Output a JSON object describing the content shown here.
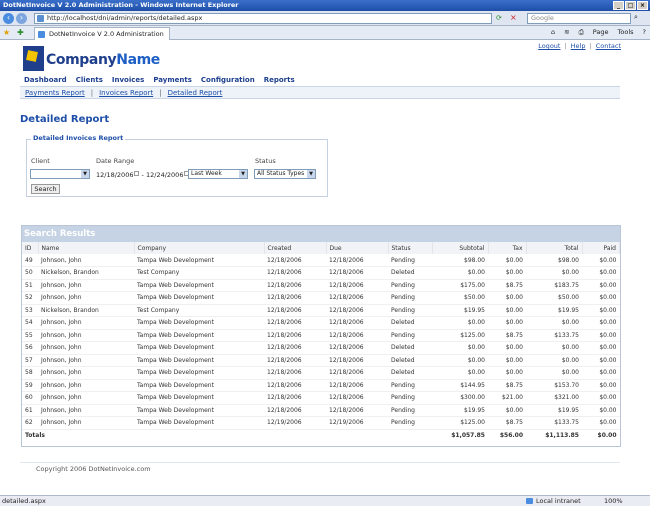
{
  "window": {
    "title": "DotNetInvoice V 2.0 Administration - Windows Internet Explorer"
  },
  "browser": {
    "url": "http://localhost/dni/admin/reports/detailed.aspx",
    "search_placeholder": "Google",
    "tab_title": "DotNetInvoice V 2.0 Administration",
    "tools": {
      "page": "Page",
      "tools": "Tools"
    }
  },
  "header": {
    "company_first": "Company",
    "company_second": "Name",
    "toplinks": [
      "Logout",
      "Help",
      "Contact"
    ]
  },
  "mainnav": [
    "Dashboard",
    "Clients",
    "Invoices",
    "Payments",
    "Configuration",
    "Reports"
  ],
  "subnav": [
    "Payments Report",
    "Invoices Report",
    "Detailed Report"
  ],
  "page_title": "Detailed Report",
  "filters": {
    "legend": "Detailed Invoices Report",
    "client_label": "Client",
    "date_label": "Date Range",
    "date_from": "12/18/2006",
    "date_sep": "-",
    "date_to": "12/24/2006",
    "range_option": "Last Week",
    "status_label": "Status",
    "status_option": "All Status Types",
    "search_button": "Search"
  },
  "results": {
    "title": "Search Results",
    "columns": [
      "ID",
      "Name",
      "Company",
      "Created",
      "Due",
      "Status",
      "Subtotal",
      "Tax",
      "Total",
      "Paid"
    ],
    "rows": [
      [
        "49",
        "Johnson, John",
        "Tampa Web Development",
        "12/18/2006",
        "12/18/2006",
        "Pending",
        "$98.00",
        "$0.00",
        "$98.00",
        "$0.00"
      ],
      [
        "50",
        "Nickelson, Brandon",
        "Test Company",
        "12/18/2006",
        "12/18/2006",
        "Deleted",
        "$0.00",
        "$0.00",
        "$0.00",
        "$0.00"
      ],
      [
        "51",
        "Johnson, John",
        "Tampa Web Development",
        "12/18/2006",
        "12/18/2006",
        "Pending",
        "$175.00",
        "$8.75",
        "$183.75",
        "$0.00"
      ],
      [
        "52",
        "Johnson, John",
        "Tampa Web Development",
        "12/18/2006",
        "12/18/2006",
        "Pending",
        "$50.00",
        "$0.00",
        "$50.00",
        "$0.00"
      ],
      [
        "53",
        "Nickelson, Brandon",
        "Test Company",
        "12/18/2006",
        "12/18/2006",
        "Pending",
        "$19.95",
        "$0.00",
        "$19.95",
        "$0.00"
      ],
      [
        "54",
        "Johnson, John",
        "Tampa Web Development",
        "12/18/2006",
        "12/18/2006",
        "Deleted",
        "$0.00",
        "$0.00",
        "$0.00",
        "$0.00"
      ],
      [
        "55",
        "Johnson, John",
        "Tampa Web Development",
        "12/18/2006",
        "12/18/2006",
        "Pending",
        "$125.00",
        "$8.75",
        "$133.75",
        "$0.00"
      ],
      [
        "56",
        "Johnson, John",
        "Tampa Web Development",
        "12/18/2006",
        "12/18/2006",
        "Deleted",
        "$0.00",
        "$0.00",
        "$0.00",
        "$0.00"
      ],
      [
        "57",
        "Johnson, John",
        "Tampa Web Development",
        "12/18/2006",
        "12/18/2006",
        "Deleted",
        "$0.00",
        "$0.00",
        "$0.00",
        "$0.00"
      ],
      [
        "58",
        "Johnson, John",
        "Tampa Web Development",
        "12/18/2006",
        "12/18/2006",
        "Deleted",
        "$0.00",
        "$0.00",
        "$0.00",
        "$0.00"
      ],
      [
        "59",
        "Johnson, John",
        "Tampa Web Development",
        "12/18/2006",
        "12/18/2006",
        "Pending",
        "$144.95",
        "$8.75",
        "$153.70",
        "$0.00"
      ],
      [
        "60",
        "Johnson, John",
        "Tampa Web Development",
        "12/18/2006",
        "12/18/2006",
        "Pending",
        "$300.00",
        "$21.00",
        "$321.00",
        "$0.00"
      ],
      [
        "61",
        "Johnson, John",
        "Tampa Web Development",
        "12/18/2006",
        "12/18/2006",
        "Pending",
        "$19.95",
        "$0.00",
        "$19.95",
        "$0.00"
      ],
      [
        "62",
        "Johnson, John",
        "Tampa Web Development",
        "12/19/2006",
        "12/19/2006",
        "Pending",
        "$125.00",
        "$8.75",
        "$133.75",
        "$0.00"
      ]
    ],
    "totals": {
      "label": "Totals",
      "subtotal": "$1,057.85",
      "tax": "$56.00",
      "total": "$1,113.85",
      "paid": "$0.00"
    }
  },
  "footer": {
    "copyright": "Copyright 2006 DotNetInvoice.com"
  },
  "statusbar": {
    "left": "detailed.aspx",
    "zone": "Local intranet",
    "zoom": "100%"
  },
  "colors": {
    "brand_blue": "#1d4ea8",
    "results_header": "#c5d3e4"
  }
}
